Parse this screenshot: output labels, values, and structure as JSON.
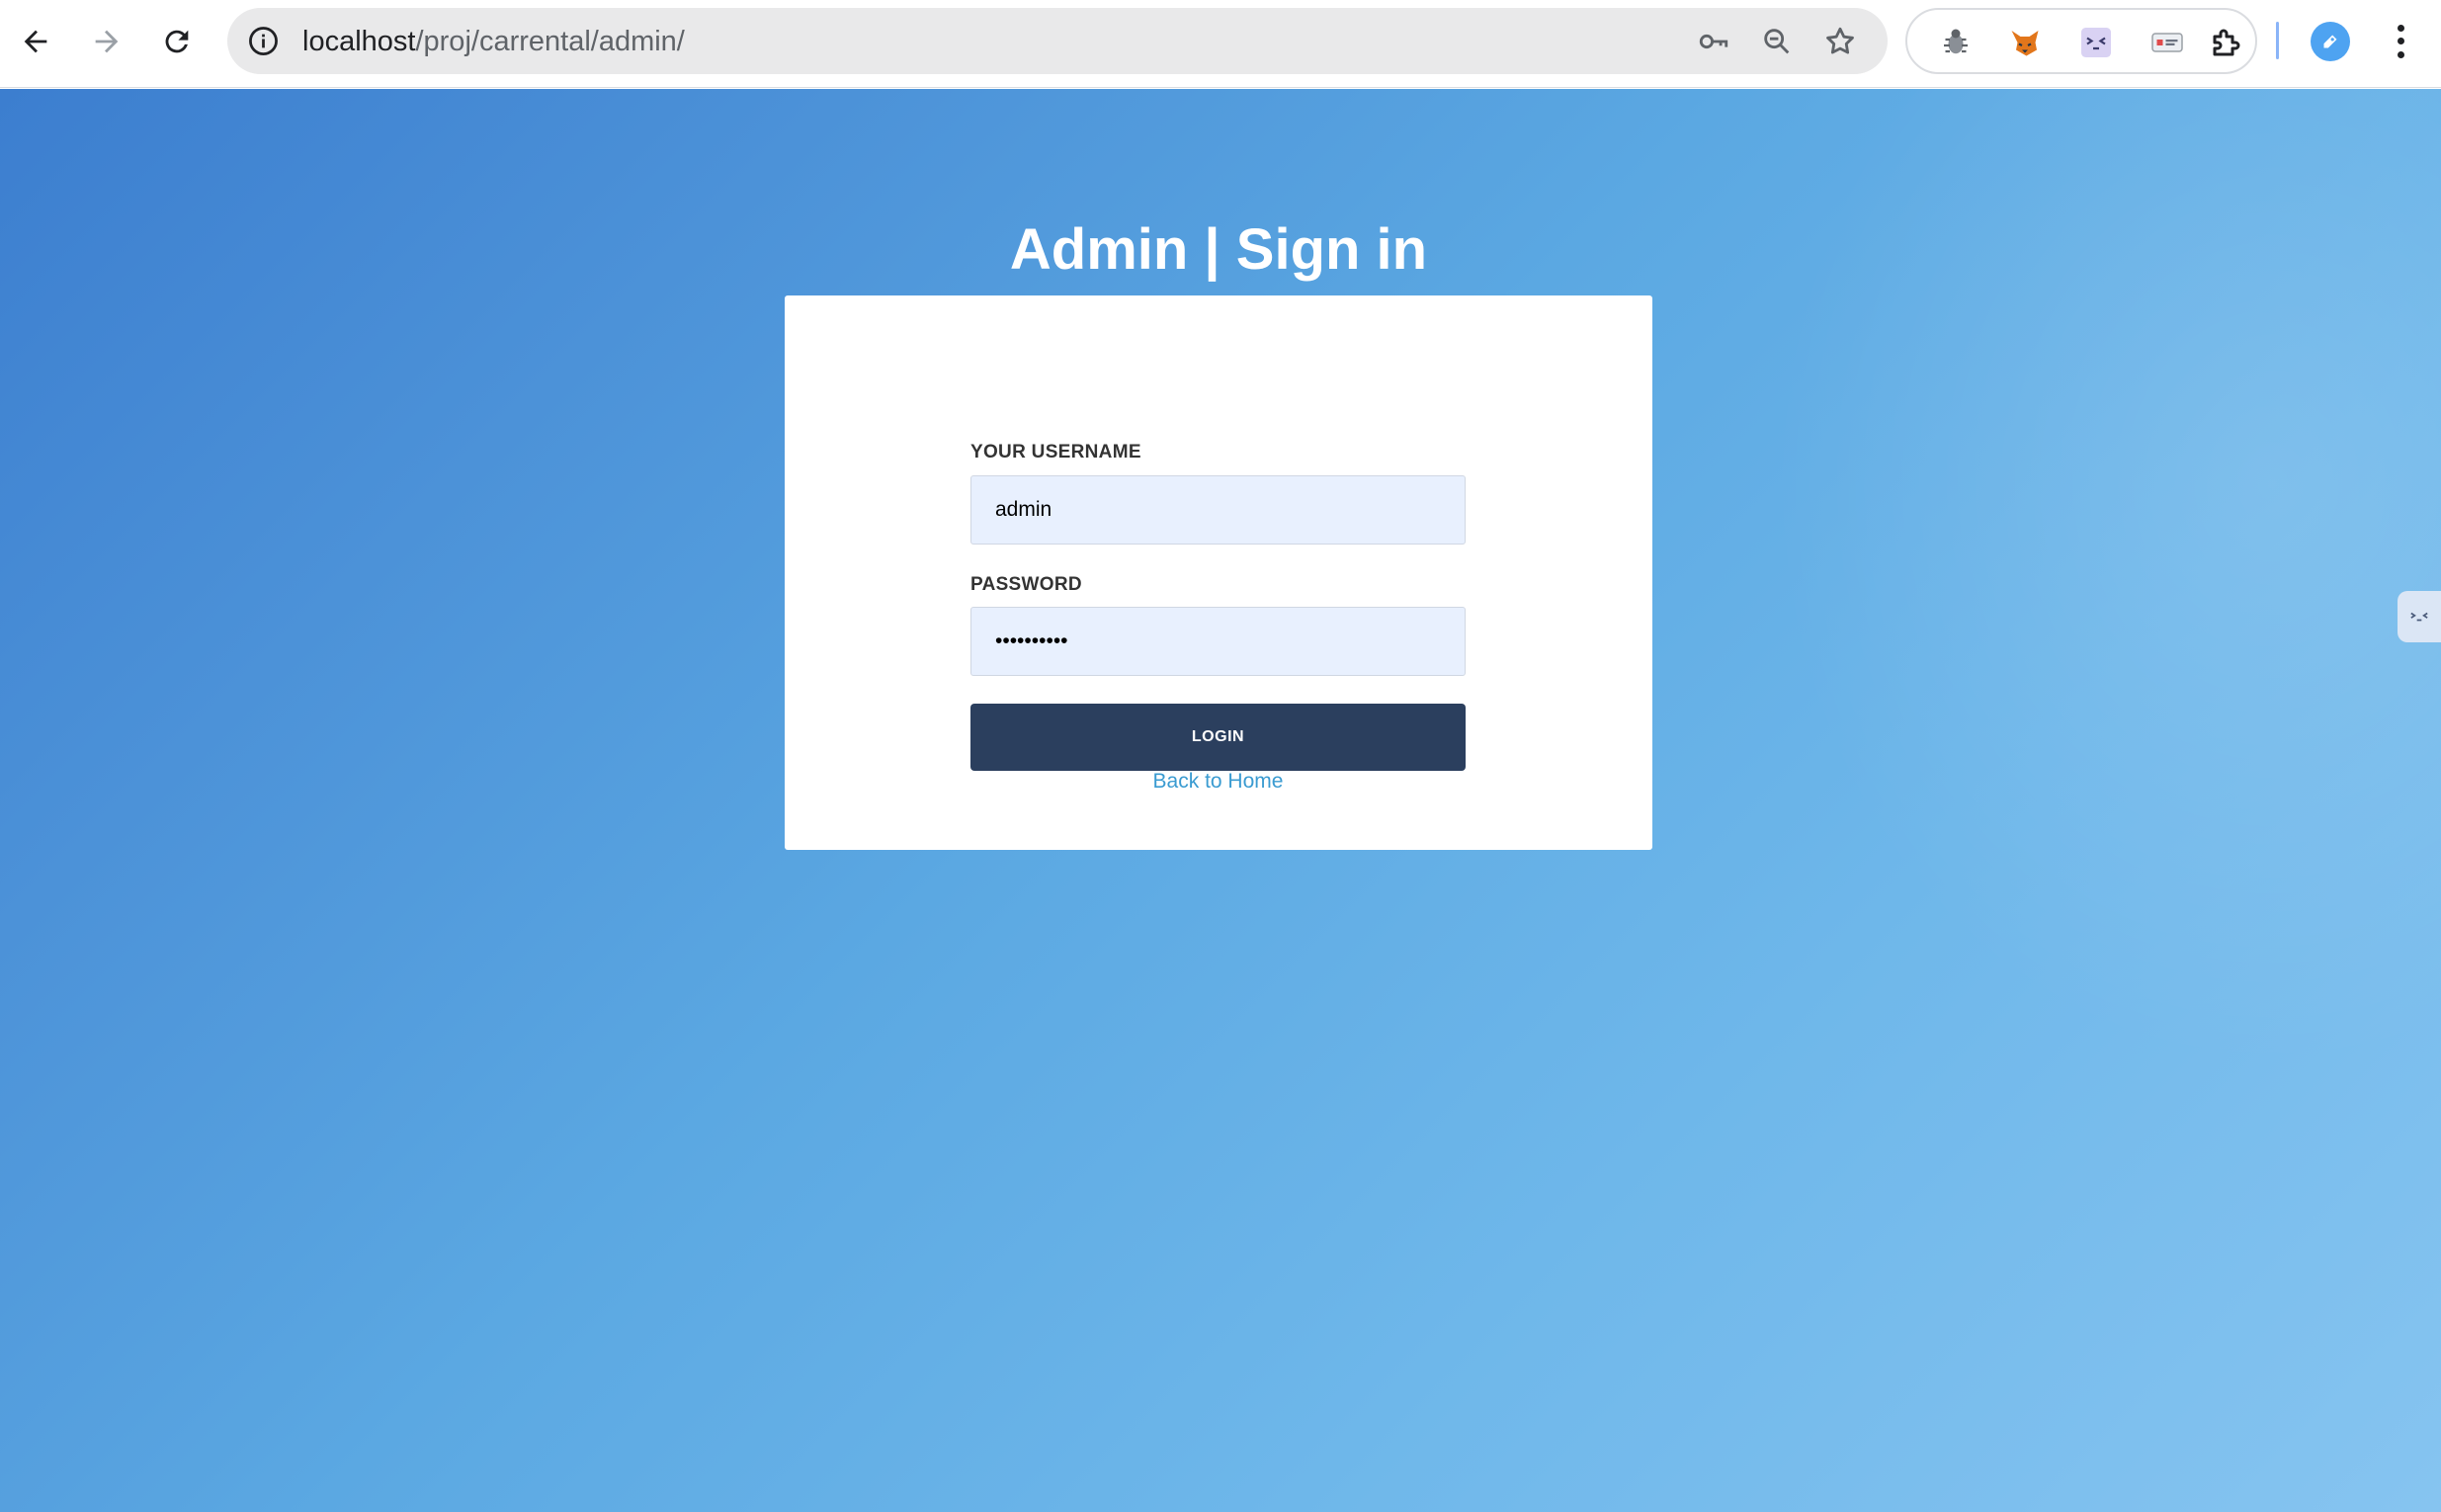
{
  "browser": {
    "url_host": "localhost",
    "url_path": "/proj/carrental/admin/",
    "icons": [
      "back-arrow-icon",
      "forward-arrow-icon",
      "reload-icon",
      "info-icon",
      "key-icon",
      "zoom-out-icon",
      "star-icon",
      "bug-extension-icon",
      "fox-extension-icon",
      "face-extension-icon",
      "card-extension-icon",
      "puzzle-icon",
      "profile-icon",
      "kebab-menu-icon"
    ]
  },
  "page": {
    "title": "Admin | Sign in",
    "username_label": "YOUR USERNAME",
    "username_value": "admin",
    "password_label": "PASSWORD",
    "password_value": "••••••••••",
    "login_label": "LOGIN",
    "back_link": "Back to Home"
  },
  "colors": {
    "background_gradient_start": "#3c7ecf",
    "background_gradient_end": "#86c4f0",
    "button": "#2b3f5e",
    "link": "#3a9bd1",
    "input_bg": "#e8f0fe"
  }
}
